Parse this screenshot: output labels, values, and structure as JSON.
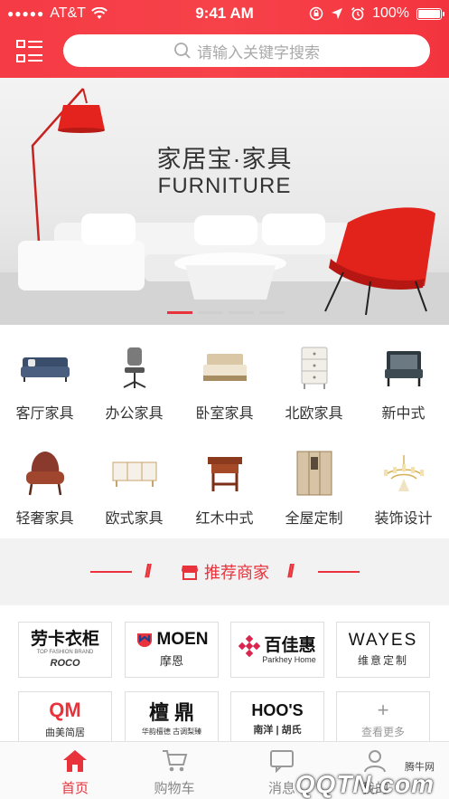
{
  "status_bar": {
    "carrier": "AT&T",
    "time": "9:41 AM",
    "battery": "100%"
  },
  "header": {
    "search_placeholder": "请输入关键字搜索"
  },
  "banner": {
    "title": "家居宝·家具",
    "subtitle": "FURNITURE",
    "slide_count": 4,
    "active_slide": 1
  },
  "categories": [
    {
      "label": "客厅家具",
      "icon": "sofa-icon"
    },
    {
      "label": "办公家具",
      "icon": "office-chair-icon"
    },
    {
      "label": "卧室家具",
      "icon": "bed-icon"
    },
    {
      "label": "北欧家具",
      "icon": "cabinet-icon"
    },
    {
      "label": "新中式",
      "icon": "armchair-icon"
    },
    {
      "label": "轻奢家具",
      "icon": "luxury-chair-icon"
    },
    {
      "label": "欧式家具",
      "icon": "tv-stand-icon"
    },
    {
      "label": "红木中式",
      "icon": "wooden-stool-icon"
    },
    {
      "label": "全屋定制",
      "icon": "wardrobe-icon"
    },
    {
      "label": "装饰设计",
      "icon": "chandelier-icon"
    }
  ],
  "section": {
    "title": "推荐商家"
  },
  "merchants": [
    {
      "name": "劳卡衣柜",
      "sub": "ROCO",
      "tiny": "TOP FASHION BRAND"
    },
    {
      "name": "MOEN",
      "sub": "摩恩"
    },
    {
      "name": "百佳惠",
      "sub": "Parkhey Home"
    },
    {
      "name": "WAYES",
      "sub": "维意定制"
    },
    {
      "name": "QM",
      "sub": "曲美简居"
    },
    {
      "name": "檀 鼎",
      "sub": "华韵檀德  古调梨臻"
    },
    {
      "name": "HOO'S",
      "sub": "南洋 | 胡氏"
    },
    {
      "name": "+",
      "sub": "查看更多"
    }
  ],
  "tabbar": {
    "items": [
      {
        "label": "首页",
        "icon": "home-icon"
      },
      {
        "label": "购物车",
        "icon": "cart-icon"
      },
      {
        "label": "消息",
        "icon": "message-icon"
      },
      {
        "label": "我的",
        "icon": "user-icon"
      }
    ]
  },
  "watermark": {
    "small": "腾牛网",
    "big": "QQTN.com"
  },
  "colors": {
    "accent": "#e8323c",
    "header": "#f53b45"
  }
}
